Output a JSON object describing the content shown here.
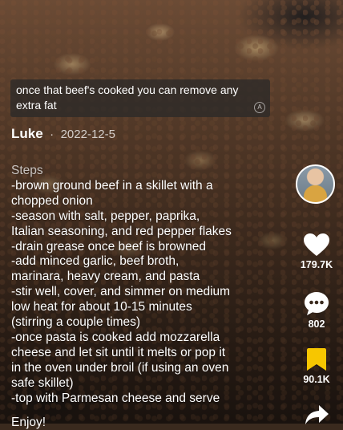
{
  "caption": {
    "text": "once that beef's cooked you can remove any extra fat"
  },
  "author": {
    "name": "Luke",
    "separator": "·",
    "date": "2022-12-5"
  },
  "description": {
    "heading": "Steps",
    "lines": [
      "-brown ground beef in a skillet with a",
      "chopped onion",
      "-season with salt, pepper, paprika,",
      "Italian seasoning, and red pepper flakes",
      "-drain grease once beef is browned",
      "-add minced garlic, beef broth,",
      "marinara, heavy cream, and pasta",
      "-stir well, cover, and simmer on medium",
      "low heat for about 10-15 minutes",
      "(stirring a couple times)",
      "-once pasta is cooked add mozzarella",
      "cheese and let sit until it melts or pop it",
      "in the oven under broil (if using an oven",
      "safe skillet)",
      "-top with Parmesan cheese and serve"
    ],
    "partial_next_line": "Enjoy!"
  },
  "actions": {
    "likes": "179.7K",
    "comments": "802",
    "saves": "90.1K"
  },
  "icons": {
    "like": "heart-icon",
    "comment": "comment-bubble-icon",
    "save": "bookmark-icon",
    "share": "share-arrow-icon",
    "translate": "translate-icon"
  },
  "colors": {
    "save_active": "#f7c600",
    "text": "#ffffff"
  }
}
